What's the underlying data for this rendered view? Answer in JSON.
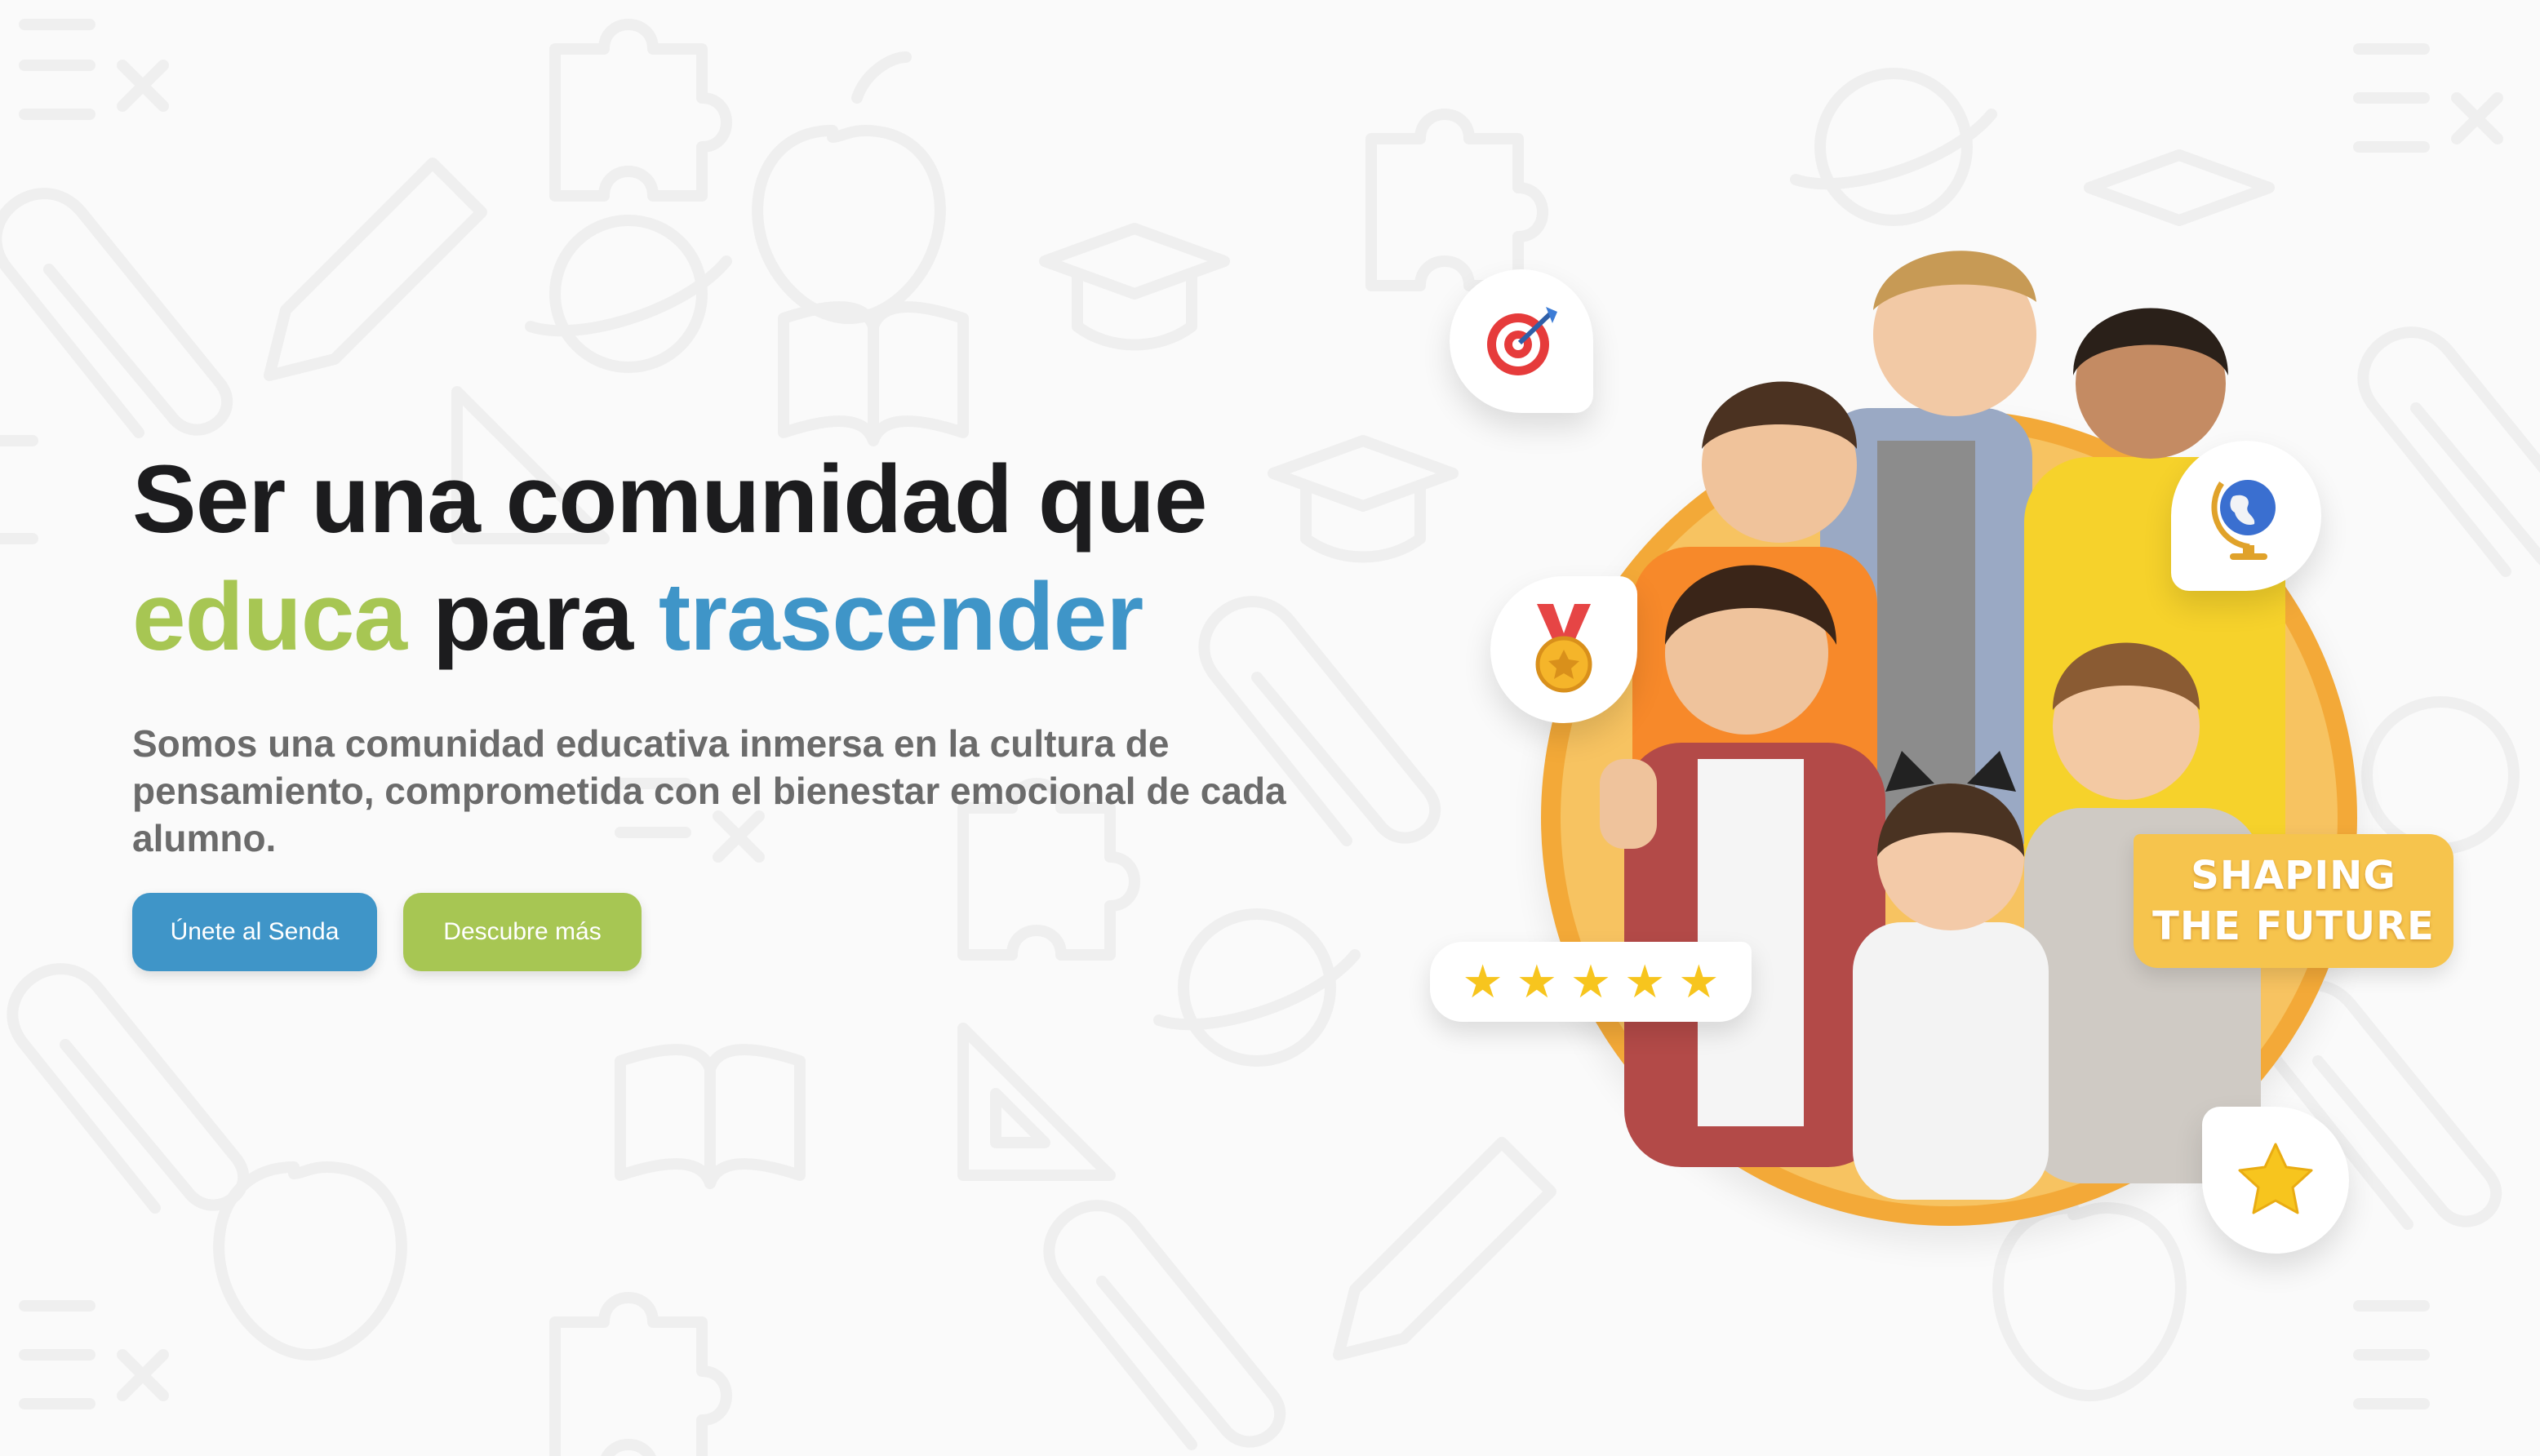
{
  "hero": {
    "title_line1": "Ser una comunidad que",
    "title_word_green": "educa",
    "title_word_mid": " para ",
    "title_word_blue": "trascender",
    "description": "Somos una comunidad educativa inmersa en la cultura de pensamiento, comprometida con el bienestar emocional de cada alumno."
  },
  "buttons": {
    "primary_label": "Únete al Senda",
    "secondary_label": "Descubre más"
  },
  "illustration": {
    "badge_line1": "SHAPING",
    "badge_line2": "THE FUTURE",
    "rating_stars": 5,
    "icons": [
      "target-icon",
      "medal-icon",
      "globe-icon",
      "star-icon"
    ]
  },
  "colors": {
    "green": "#a7c653",
    "blue": "#3f95c8",
    "orange": "#f3a938",
    "yellow": "#f6c44d",
    "dark": "#1c1c1e"
  }
}
